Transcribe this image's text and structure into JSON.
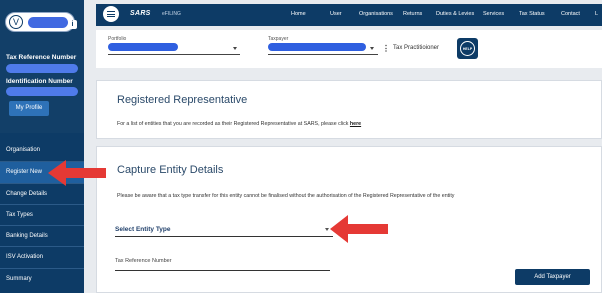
{
  "user": {
    "initial": "V",
    "info_icon": "i"
  },
  "sidebar": {
    "tax_reference_label": "Tax Reference Number",
    "identification_label": "Identification Number",
    "profile_button": "My Profile",
    "menu": [
      {
        "label": "Organisation",
        "header": true
      },
      {
        "label": "Register New",
        "active": true
      },
      {
        "label": "Change Details"
      },
      {
        "label": "Tax Types"
      },
      {
        "label": "Banking Details"
      },
      {
        "label": "ISV Activation"
      },
      {
        "label": "Summary"
      }
    ]
  },
  "topbar": {
    "logo": "SARS",
    "logo_sub": "eFILING",
    "nav": [
      "Home",
      "User",
      "Organisations",
      "Returns",
      "Duties & Levies",
      "Services",
      "Tax Status",
      "Contact",
      "L"
    ]
  },
  "selectors": {
    "portfolio_label": "Portfolio",
    "taxpayer_label": "Taxpayer",
    "taxpayer_role": "Tax Practitioioner",
    "help_badge": "HELP YOU"
  },
  "registered_rep": {
    "title": "Registered Representative",
    "text": "For a list of entities that you are recorded as their Registered Representative at SARS, please click",
    "link": "here"
  },
  "capture": {
    "title": "Capture Entity Details",
    "notice": "Please be aware that a tax type transfer for this entity cannot be finalised without the authorisation of the Registered Representative of the entity",
    "entity_type_value": "Select Entity Type",
    "tax_ref_label": "Tax Reference Number",
    "add_button": "Add Taxpayer"
  },
  "colors": {
    "navy": "#0d3b66",
    "blur_blue": "#2f5fe0",
    "arrow_red": "#e53935"
  }
}
